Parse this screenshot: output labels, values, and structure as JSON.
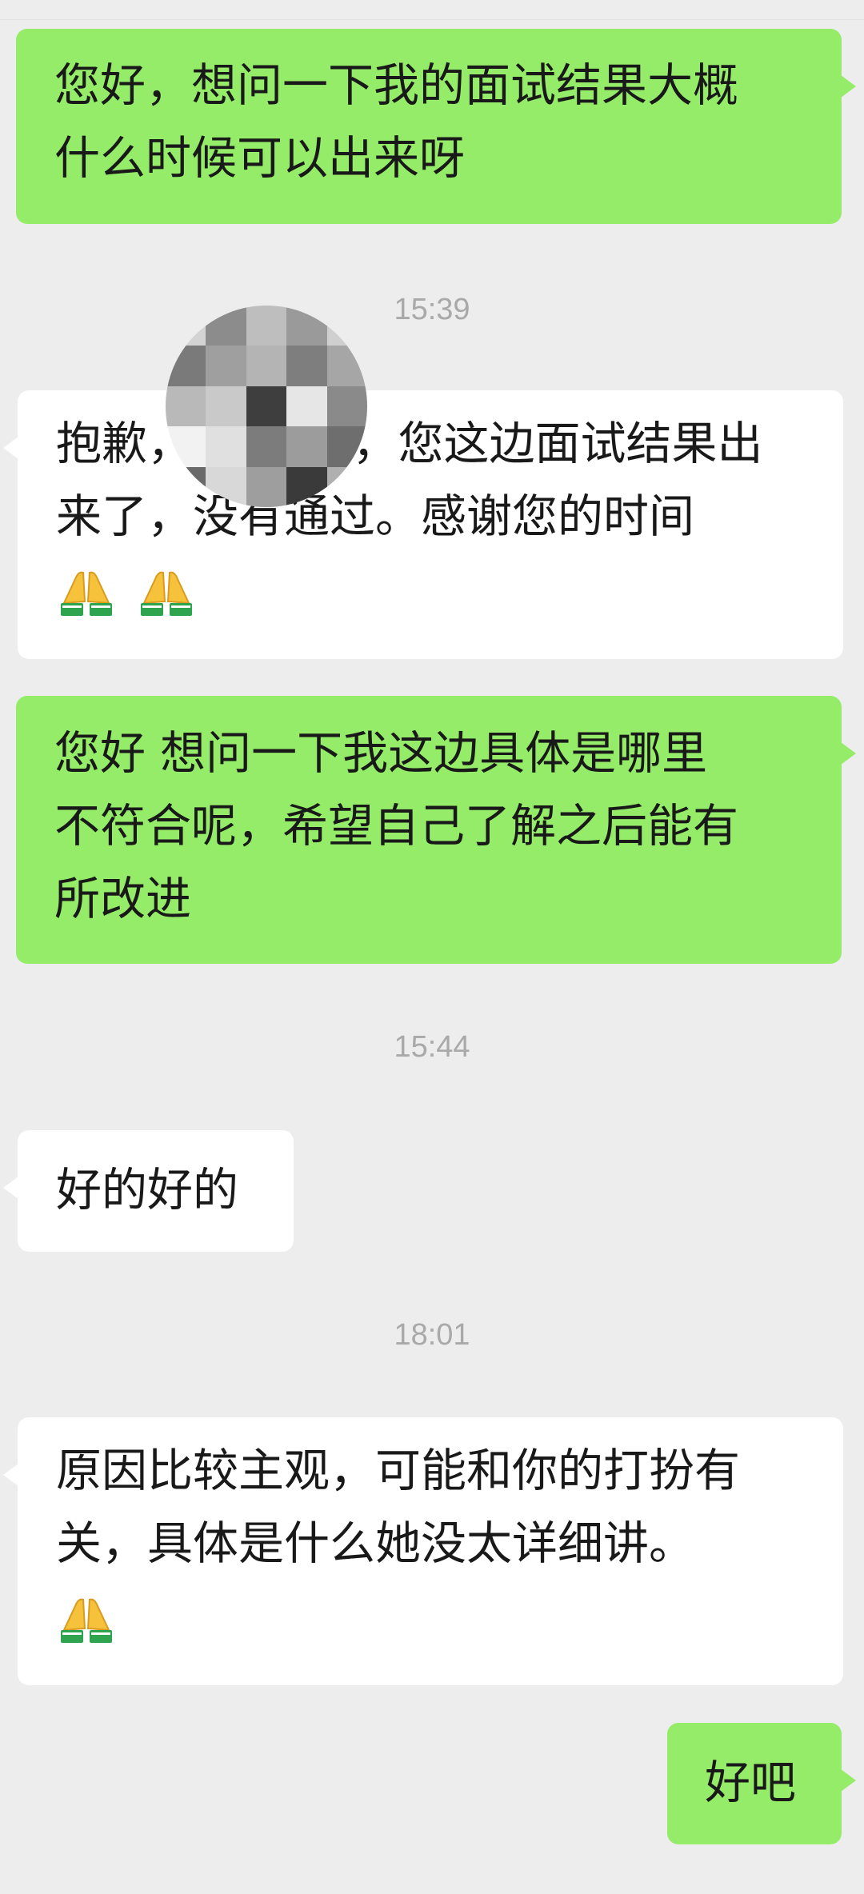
{
  "messages": [
    {
      "id": "m1",
      "side": "out",
      "lines": [
        "您好，想问一下我的面试结果大概",
        "什么时候可以出来呀"
      ]
    },
    {
      "id": "t1",
      "type": "time",
      "text": "15:39"
    },
    {
      "id": "m2",
      "side": "in",
      "lines": [
        "抱歉，　　　　，您这边面试结果出",
        "来了，没有通过。感谢您的时间"
      ],
      "emoji": [
        "pray-icon",
        "pray-icon"
      ]
    },
    {
      "id": "m3",
      "side": "out",
      "lines": [
        "您好 想问一下我这边具体是哪里",
        "不符合呢，希望自己了解之后能有",
        "所改进"
      ]
    },
    {
      "id": "t2",
      "type": "time",
      "text": "15:44"
    },
    {
      "id": "m4",
      "side": "in",
      "lines": [
        "好的好的"
      ]
    },
    {
      "id": "t3",
      "type": "time",
      "text": "18:01"
    },
    {
      "id": "m5",
      "side": "in",
      "lines": [
        "原因比较主观，可能和你的打扮有",
        "关，具体是什么她没太详细讲。"
      ],
      "emoji": [
        "pray-icon"
      ]
    },
    {
      "id": "m6",
      "side": "out",
      "lines": [
        "好吧"
      ]
    }
  ],
  "colors": {
    "background": "#EDEDED",
    "outgoing_bubble": "#95EC69",
    "incoming_bubble": "#FFFFFF",
    "text": "#191919",
    "timestamp": "#A9A9A9"
  },
  "censor_overlay": "pixelated-mosaic"
}
